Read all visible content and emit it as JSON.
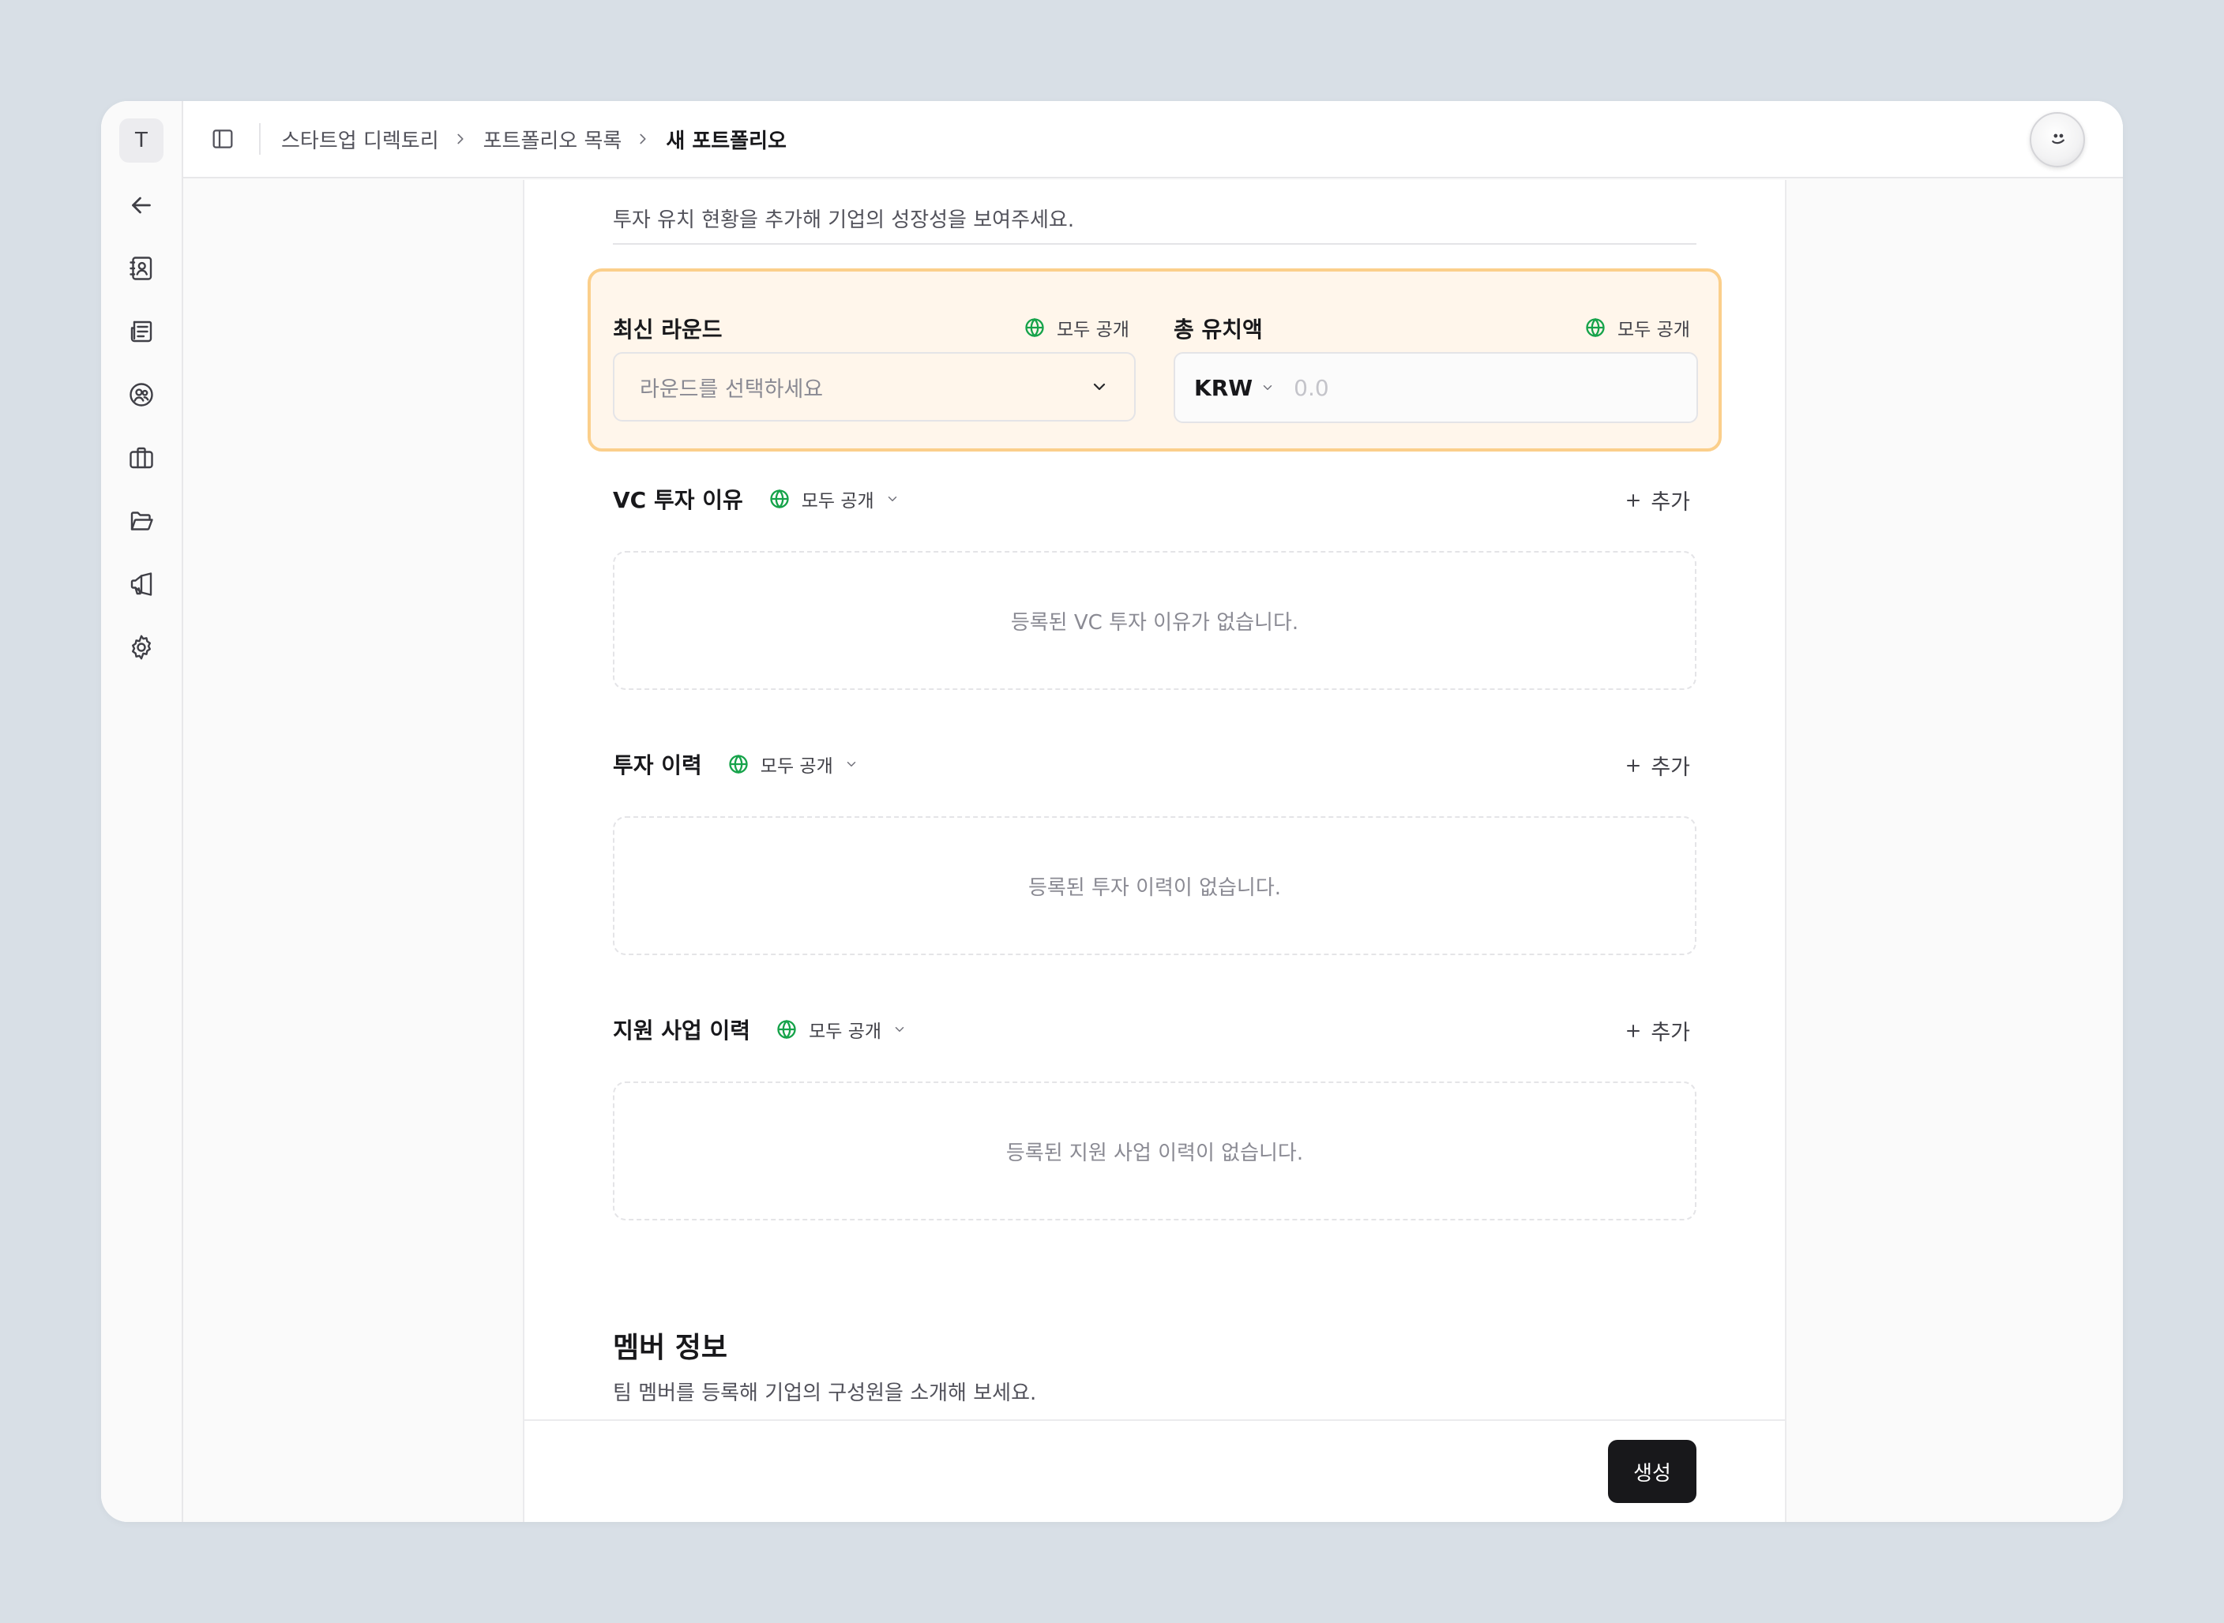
{
  "sidebar": {
    "workspace_initial": "T"
  },
  "header": {
    "breadcrumb": [
      "스타트업 디렉토리",
      "포트폴리오 목록",
      "새 포트폴리오"
    ]
  },
  "investment": {
    "description": "투자 유치 현황을 추가해 기업의 성장성을 보여주세요.",
    "latest_round": {
      "label": "최신 라운드",
      "visibility": "모두 공개",
      "placeholder": "라운드를 선택하세요"
    },
    "total_amount": {
      "label": "총 유치액",
      "visibility": "모두 공개",
      "currency": "KRW",
      "placeholder": "0.0"
    },
    "vc_reason": {
      "title": "VC 투자 이유",
      "visibility": "모두 공개",
      "add_label": "추가",
      "empty_text": "등록된 VC 투자 이유가 없습니다."
    },
    "history": {
      "title": "투자 이력",
      "visibility": "모두 공개",
      "add_label": "추가",
      "empty_text": "등록된 투자 이력이 없습니다."
    },
    "support": {
      "title": "지원 사업 이력",
      "visibility": "모두 공개",
      "add_label": "추가",
      "empty_text": "등록된 지원 사업 이력이 없습니다."
    }
  },
  "members": {
    "title": "멤버 정보",
    "description": "팀 멤버를 등록해 기업의 구성원을 소개해 보세요."
  },
  "footer": {
    "create_label": "생성"
  },
  "colors": {
    "accent_border": "#fbcf8b",
    "accent_fill": "#fff6eb",
    "globe": "#16a34a",
    "primary_button": "#18181b"
  }
}
